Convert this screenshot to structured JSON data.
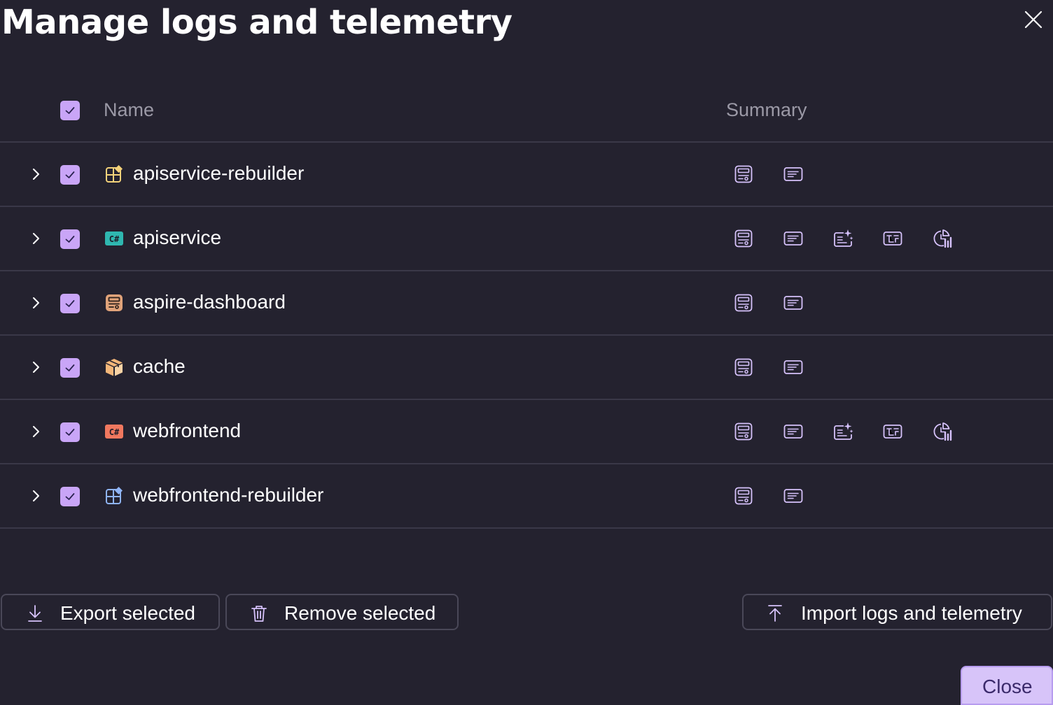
{
  "dialog": {
    "title": "Manage logs and telemetry",
    "close_icon": "close-icon"
  },
  "grid": {
    "header": {
      "name": "Name",
      "summary": "Summary",
      "select_all_checked": true
    },
    "rows": [
      {
        "name": "apiservice-rebuilder",
        "checked": true,
        "type_icon": "executable-icon",
        "type_color": "#f4d27a",
        "summary_icons": [
          "console-logs-icon",
          "structured-logs-icon"
        ]
      },
      {
        "name": "apiservice",
        "checked": true,
        "type_icon": "csharp-project-icon",
        "type_color": "#2fb7b0",
        "summary_icons": [
          "console-logs-icon",
          "structured-logs-icon",
          "traces-icon",
          "spans-icon",
          "metrics-icon"
        ]
      },
      {
        "name": "aspire-dashboard",
        "checked": true,
        "type_icon": "container-app-icon",
        "type_color": "#e0a37a",
        "summary_icons": [
          "console-logs-icon",
          "structured-logs-icon"
        ]
      },
      {
        "name": "cache",
        "checked": true,
        "type_icon": "container-icon",
        "type_color": "#f4b77a",
        "summary_icons": [
          "console-logs-icon",
          "structured-logs-icon"
        ]
      },
      {
        "name": "webfrontend",
        "checked": true,
        "type_icon": "csharp-project-icon",
        "type_color": "#f0785f",
        "summary_icons": [
          "console-logs-icon",
          "structured-logs-icon",
          "traces-icon",
          "spans-icon",
          "metrics-icon"
        ]
      },
      {
        "name": "webfrontend-rebuilder",
        "checked": true,
        "type_icon": "executable-icon",
        "type_color": "#8fb4f5",
        "summary_icons": [
          "console-logs-icon",
          "structured-logs-icon"
        ]
      }
    ]
  },
  "actions": {
    "export_label": "Export selected",
    "remove_label": "Remove selected",
    "import_label": "Import logs and telemetry",
    "close_label": "Close"
  },
  "colors": {
    "background": "#24222f",
    "accent": "#c9a5f7",
    "icon_purple": "#d6c2fb",
    "divider": "#3a3848"
  }
}
